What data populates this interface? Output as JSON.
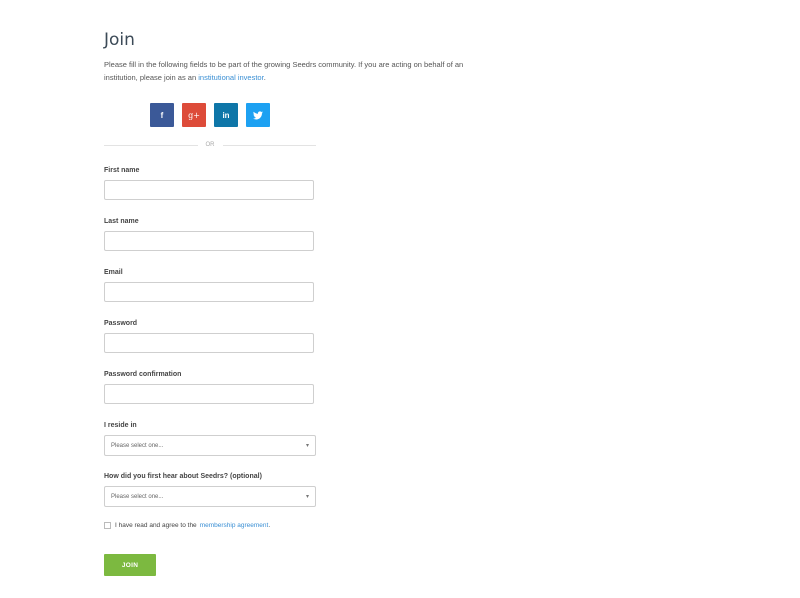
{
  "title": "Join",
  "intro": {
    "text_before": "Please fill in the following fields to be part of the growing Seedrs community. If you are acting on behalf of an institution, please join as an ",
    "link_text": "institutional investor",
    "text_after": "."
  },
  "social": {
    "facebook": {
      "glyph": "f",
      "color": "#3b5998"
    },
    "google": {
      "glyph": "g+",
      "color": "#dd4b39"
    },
    "linkedin": {
      "glyph": "in",
      "color": "#0e76a8"
    },
    "twitter": {
      "glyph": "♥",
      "color": "#1da1f2"
    }
  },
  "divider_text": "OR",
  "fields": {
    "first_name": {
      "label": "First name",
      "value": ""
    },
    "last_name": {
      "label": "Last name",
      "value": ""
    },
    "email": {
      "label": "Email",
      "value": ""
    },
    "password": {
      "label": "Password",
      "value": ""
    },
    "password_confirmation": {
      "label": "Password confirmation",
      "value": ""
    }
  },
  "reside": {
    "label": "I reside in",
    "selected": "Please select one..."
  },
  "heard": {
    "label": "How did you first hear about Seedrs? (optional)",
    "selected": "Please select one..."
  },
  "agreement": {
    "text": "I have read and agree to the",
    "link_text": "membership agreement",
    "suffix": "."
  },
  "join_button": "JOIN"
}
